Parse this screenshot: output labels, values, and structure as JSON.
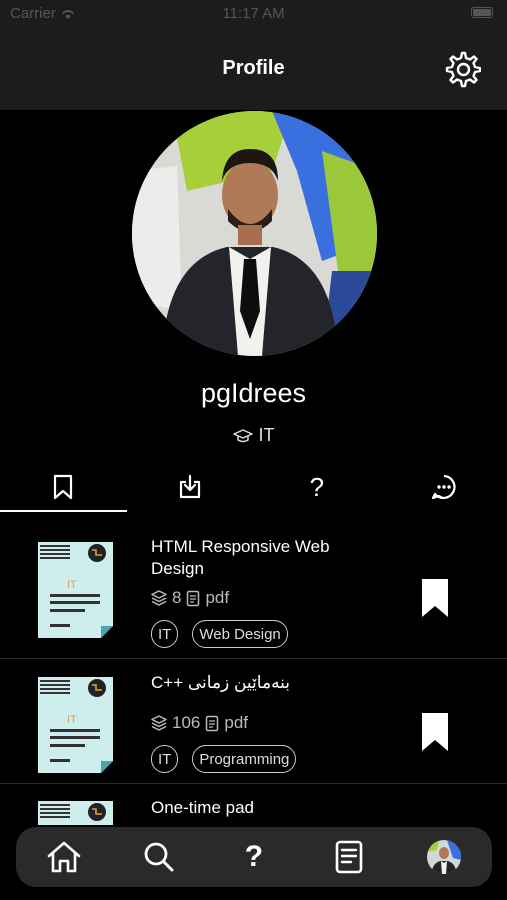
{
  "status_bar": {
    "carrier": "Carrier",
    "time": "11:17 AM"
  },
  "nav": {
    "title": "Profile"
  },
  "profile": {
    "username": "pgIdrees",
    "department": "IT"
  },
  "tabs": [
    {
      "icon": "bookmark-icon",
      "active": true
    },
    {
      "icon": "download-icon",
      "active": false
    },
    {
      "icon": "question-icon",
      "label": "?",
      "active": false
    },
    {
      "icon": "chat-icon",
      "active": false
    }
  ],
  "documents": [
    {
      "thumb_label": "IT",
      "title": "HTML Responsive Web Design",
      "pages": "8",
      "format": "pdf",
      "tags": [
        "IT",
        "Web Design"
      ]
    },
    {
      "thumb_label": "IT",
      "title": "بنەماێین زمانی ++C",
      "pages": "106",
      "format": "pdf",
      "tags": [
        "IT",
        "Programming"
      ]
    },
    {
      "thumb_label": "IT",
      "title": "One-time pad"
    }
  ],
  "bottom_tabs": [
    {
      "icon": "home-icon"
    },
    {
      "icon": "search-icon"
    },
    {
      "icon": "question-icon",
      "label": "?"
    },
    {
      "icon": "document-icon"
    },
    {
      "icon": "avatar"
    }
  ]
}
